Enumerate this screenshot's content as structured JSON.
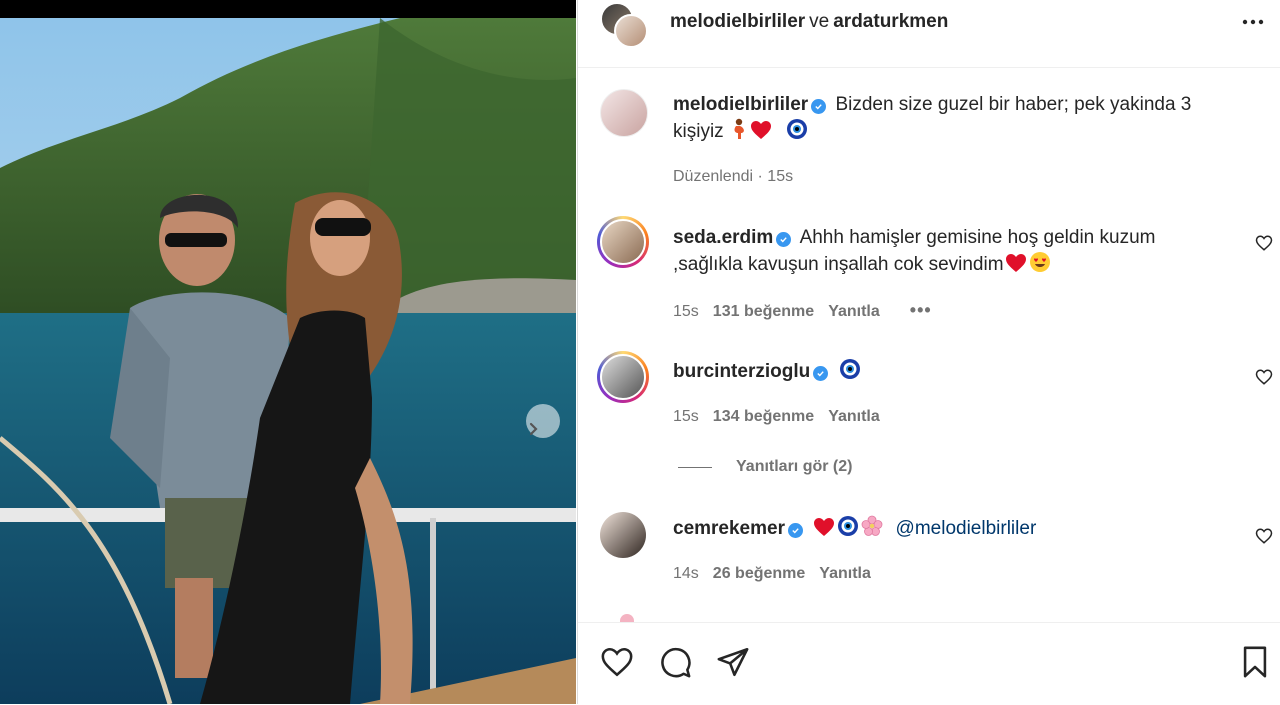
{
  "post": {
    "photo_alt": "",
    "next_icon": "chevron-right-icon"
  },
  "header": {
    "user1": "melodielbirliler",
    "connector": "ve",
    "user2": "ardaturkmen",
    "more_icon": "more-horizontal-icon"
  },
  "caption": {
    "username": "melodielbirliler",
    "text_line1": "Bizden size guzel bir haber; pek yakinda 3",
    "text_line2": "kişiyiz",
    "edited": "Düzenlendi",
    "separator": "·",
    "time": "15s"
  },
  "comments": [
    {
      "username": "seda.erdim",
      "text_line1": "Ahhh hamişler gemisine hoş geldin kuzum",
      "text_line2": ",sağlıkla kavuşun inşallah cok sevindim",
      "time": "15s",
      "likes": "131 beğenme",
      "reply": "Yanıtla",
      "more": "•••"
    },
    {
      "username": "burcinterzioglu",
      "time": "15s",
      "likes": "134 beğenme",
      "reply": "Yanıtla",
      "view_replies": "Yanıtları gör (2)"
    },
    {
      "username": "cemrekemer",
      "mention": "@melodielbirliler",
      "time": "14s",
      "likes": "26 beğenme",
      "reply": "Yanıtla"
    }
  ],
  "actions": {
    "like_icon": "heart-icon",
    "comment_icon": "comment-icon",
    "share_icon": "send-icon",
    "save_icon": "bookmark-icon"
  },
  "colors": {
    "verified": "#3897f0",
    "muted": "#737373",
    "link": "#00376b",
    "heart_emoji": "#e0102a"
  }
}
